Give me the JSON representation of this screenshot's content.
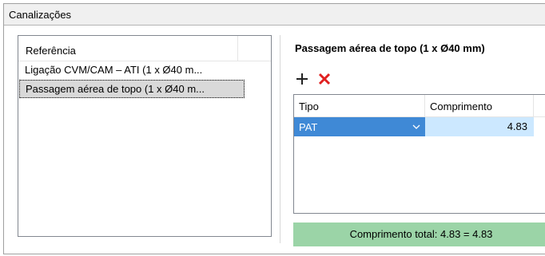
{
  "group": {
    "title": "Canalizações"
  },
  "references": {
    "header": "Referência",
    "items": [
      {
        "label": "Ligação CVM/CAM – ATI (1 x Ø40 m..."
      },
      {
        "label": "Passagem aérea de topo (1 x Ø40 m..."
      }
    ]
  },
  "detail": {
    "title": "Passagem aérea de topo (1 x Ø40 mm)",
    "toolbar": {
      "add_icon": "plus-icon",
      "remove_icon": "close-icon"
    },
    "columns": [
      "Tipo",
      "Comprimento"
    ],
    "rows": [
      {
        "tipo": "PAT",
        "comprimento": "4.83"
      }
    ],
    "total": "Comprimento total: 4.83 = 4.83"
  },
  "colors": {
    "selection_blue": "#3f89d6",
    "cell_light_blue": "#cce8ff",
    "total_green": "#9bd4a7",
    "delete_red": "#e02020"
  }
}
